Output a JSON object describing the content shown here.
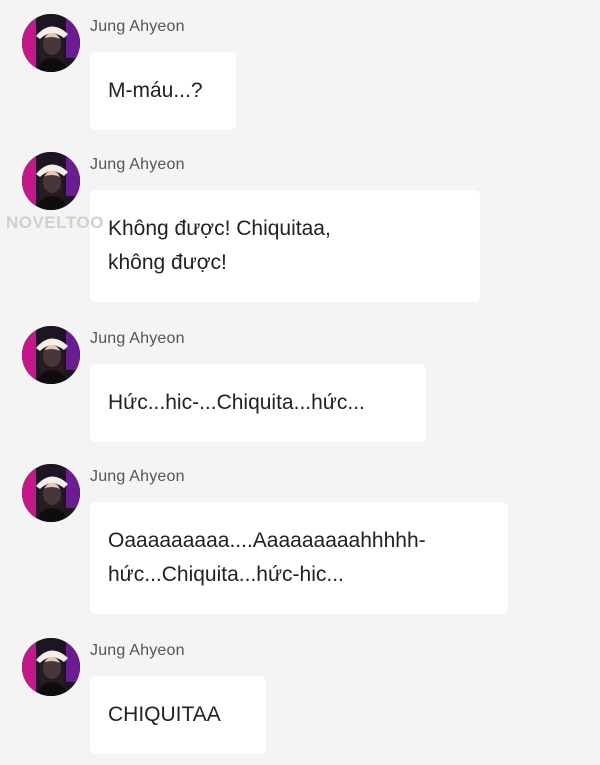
{
  "watermark": "NOVELTOO",
  "messages": [
    {
      "sender": "Jung Ahyeon",
      "text": "M-máu...?"
    },
    {
      "sender": "Jung Ahyeon",
      "text": "Không được! Chiquitaa,\nkhông được!"
    },
    {
      "sender": "Jung Ahyeon",
      "text": "Hức...hic-...Chiquita...hức..."
    },
    {
      "sender": "Jung Ahyeon",
      "text": "Oaaaaaaaaa....Aaaaaaaaahhhhh-\nhức...Chiquita...hức-hic..."
    },
    {
      "sender": "Jung Ahyeon",
      "text": "CHIQUITAA"
    }
  ],
  "icons": {
    "avatar": "user-avatar-photo"
  },
  "colors": {
    "background": "#f4f4f4",
    "bubble": "#ffffff",
    "text": "#222222",
    "name": "#555555"
  }
}
